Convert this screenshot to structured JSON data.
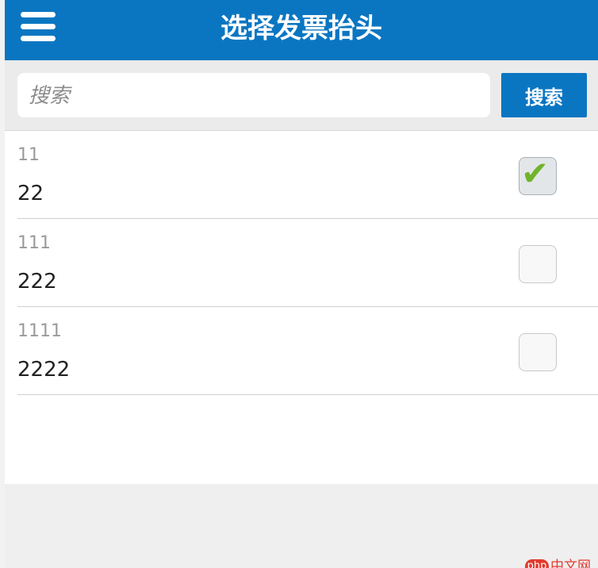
{
  "header": {
    "title": "选择发票抬头",
    "menu_icon": "hamburger-menu-icon",
    "background_color": "#0a76c2"
  },
  "search": {
    "placeholder": "搜索",
    "value": "",
    "button_label": "搜索"
  },
  "invoice_titles": [
    {
      "code": "11",
      "name": "22",
      "checked": true
    },
    {
      "code": "111",
      "name": "222",
      "checked": false
    },
    {
      "code": "1111",
      "name": "2222",
      "checked": false
    }
  ],
  "checkmark_color": "#6fb42c",
  "watermark": {
    "badge": "php",
    "text": "中文网",
    "color": "#e23a2e"
  }
}
